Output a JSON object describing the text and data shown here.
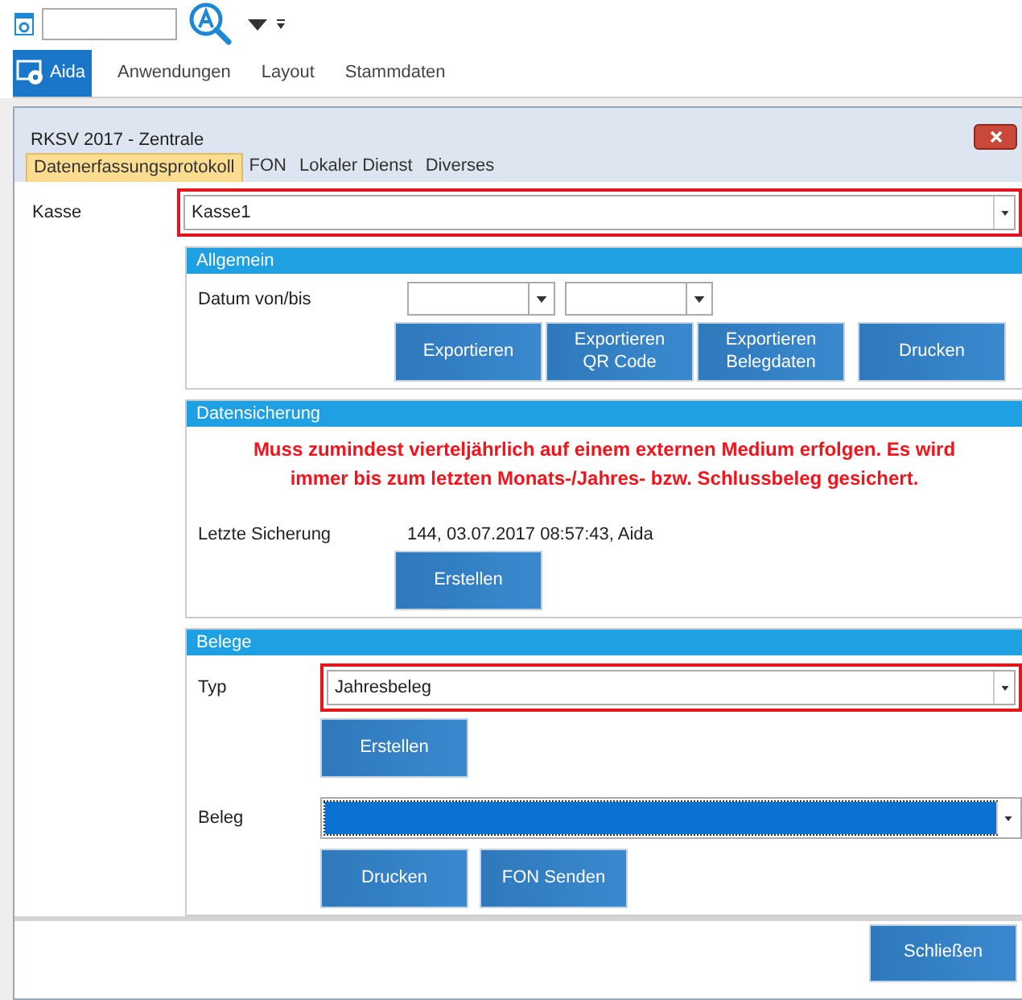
{
  "ribbon": {
    "tabs": [
      {
        "label": "Aida",
        "selected": true
      },
      {
        "label": "Anwendungen",
        "selected": false
      },
      {
        "label": "Layout",
        "selected": false
      },
      {
        "label": "Stammdaten",
        "selected": false
      }
    ]
  },
  "dialog": {
    "title": "RKSV 2017 - Zentrale",
    "tabs": [
      {
        "label": "Datenerfassungsprotokoll",
        "selected": true
      },
      {
        "label": "FON",
        "selected": false
      },
      {
        "label": "Lokaler Dienst",
        "selected": false
      },
      {
        "label": "Diverses",
        "selected": false
      }
    ],
    "kasse": {
      "label": "Kasse",
      "value": "Kasse1",
      "highlighted": true
    },
    "allgemein": {
      "title": "Allgemein",
      "date_label": "Datum von/bis",
      "buttons": [
        "Exportieren",
        "Exportieren\nQR Code",
        "Exportieren\nBelegdaten",
        "Drucken"
      ]
    },
    "datensicherung": {
      "title": "Datensicherung",
      "warning": "Muss zumindest vierteljährlich auf einem externen Medium erfolgen. Es wird immer bis zum letzten Monats-/Jahres- bzw. Schlussbeleg gesichert.",
      "last_label": "Letzte Sicherung",
      "last_value": "144, 03.07.2017 08:57:43, Aida",
      "button": "Erstellen"
    },
    "belege": {
      "title": "Belege",
      "typ": {
        "label": "Typ",
        "value": "Jahresbeleg",
        "highlighted": true
      },
      "create_button": "Erstellen",
      "beleg": {
        "label": "Beleg",
        "focused": true
      },
      "buttons": [
        "Drucken",
        "FON Senden"
      ]
    },
    "close_button": "Schließen"
  }
}
